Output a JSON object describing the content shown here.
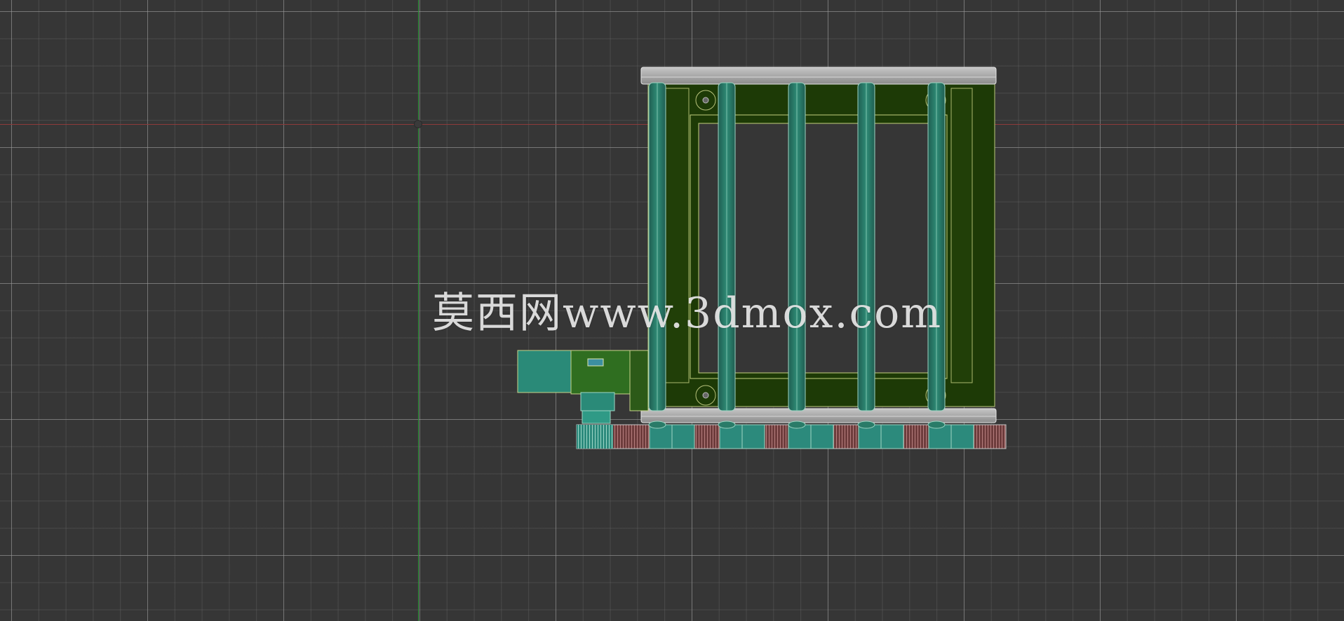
{
  "viewport": {
    "background": "#363636",
    "grid_major_color": "#9b9b9b",
    "grid_minor_color": "#6e6e6e",
    "axis_y_color": "#2f9a3a",
    "axis_x_color": "#8e3b3b"
  },
  "model": {
    "object": "barred window frame (wireframe over shaded)",
    "bar_count": 5,
    "colors": {
      "panel": "#1e3a06",
      "bar": "#2a7b68",
      "bar_edge": "#87c9b0",
      "rail": "#a8a8a8",
      "base_teal": "#2c8a7c",
      "base_red": "#8a4a4a",
      "wire": "#c8d48a"
    }
  },
  "watermark": {
    "text": "莫西网www.3dmox.com"
  },
  "icons": {
    "pivot": "pivot-icon"
  }
}
